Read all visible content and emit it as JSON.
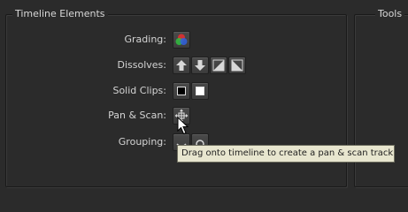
{
  "groups": {
    "timeline_elements": "Timeline Elements",
    "tools": "Tools"
  },
  "rows": {
    "grading": "Grading:",
    "dissolves": "Dissolves:",
    "solid_clips": "Solid Clips:",
    "pan_scan": "Pan & Scan:",
    "grouping": "Grouping:"
  },
  "icons": {
    "grading": "color-wheels-icon",
    "dissolves": [
      "arrow-up-icon",
      "arrow-down-icon",
      "dissolve-in-icon",
      "dissolve-out-icon"
    ],
    "solid_clips": [
      "black-solid-icon",
      "white-solid-icon"
    ],
    "pan_scan": "move-crosshair-icon",
    "grouping": [
      "group-icon",
      "ungroup-icon"
    ]
  },
  "tooltip": "Drag onto timeline to create a pan & scan track",
  "colors": {
    "panel_bg": "#2b2b2b",
    "button_bg": "#434343",
    "tooltip_bg": "#e8e6cf",
    "tooltip_text": "#1e1e1e",
    "label_text": "#d4d4d4"
  }
}
